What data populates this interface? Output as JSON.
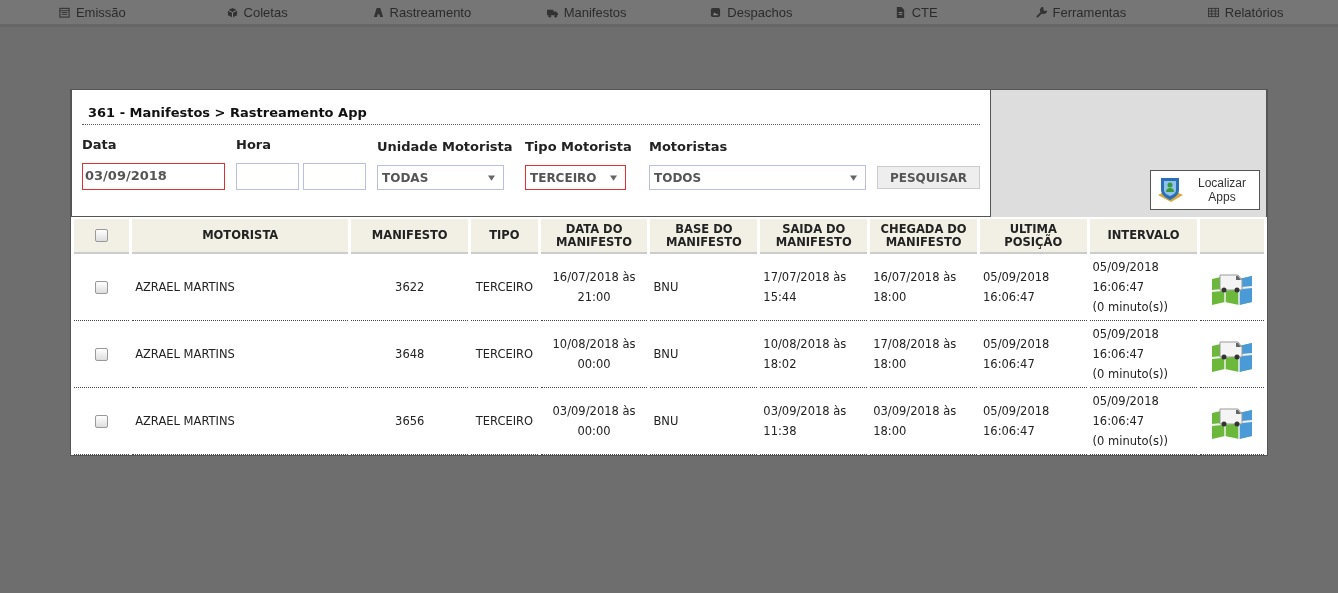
{
  "nav": [
    {
      "label": "Emissão"
    },
    {
      "label": "Coletas"
    },
    {
      "label": "Rastreamento"
    },
    {
      "label": "Manifestos"
    },
    {
      "label": "Despachos"
    },
    {
      "label": "CTE"
    },
    {
      "label": "Ferramentas"
    },
    {
      "label": "Relatórios"
    }
  ],
  "breadcrumb": "361 - Manifestos > Rastreamento App",
  "filters": [
    {
      "label": "Data",
      "kind": "input",
      "value": "03/09/2018",
      "invalid": true
    },
    {
      "label": "Hora",
      "kind": "pair",
      "invalid": false
    },
    {
      "label": "Unidade Motorista",
      "kind": "select",
      "value": "TODAS",
      "invalid": false
    },
    {
      "label": "Tipo Motorista",
      "kind": "select",
      "value": "TERCEIRO",
      "invalid": true
    },
    {
      "label": "Motoristas",
      "kind": "select",
      "value": "TODOS",
      "invalid": false
    }
  ],
  "search_button": "PESQUISAR",
  "locate_button": "Localizar Apps",
  "table": {
    "header_checked": false,
    "columns": [
      "MOTORISTA",
      "MANIFESTO",
      "TIPO",
      "DATA DO MANIFESTO",
      "BASE DO MANIFESTO",
      "SAIDA DO MANIFESTO",
      "CHEGADA DO MANIFESTO",
      "ULTIMA POSIÇÃO",
      "INTERVALO"
    ],
    "rows": [
      {
        "checked": false,
        "cells": [
          "AZRAEL MARTINS",
          "3622",
          "TERCEIRO",
          "16/07/2018 às\n21:00",
          "BNU",
          "17/07/2018 às\n15:44",
          "16/07/2018 às\n18:00",
          "05/09/2018\n16:06:47",
          "05/09/2018\n16:06:47\n(0 minuto(s))"
        ]
      },
      {
        "checked": false,
        "cells": [
          "AZRAEL MARTINS",
          "3648",
          "TERCEIRO",
          "10/08/2018 às\n00:00",
          "BNU",
          "10/08/2018 às\n18:02",
          "17/08/2018 às\n18:00",
          "05/09/2018\n16:06:47",
          "05/09/2018\n16:06:47\n(0 minuto(s))"
        ]
      },
      {
        "checked": false,
        "cells": [
          "AZRAEL MARTINS",
          "3656",
          "TERCEIRO",
          "03/09/2018 às\n00:00",
          "BNU",
          "03/09/2018 às\n11:38",
          "03/09/2018 às\n18:00",
          "05/09/2018\n16:06:47",
          "05/09/2018\n16:06:47\n(0 minuto(s))"
        ]
      }
    ]
  }
}
